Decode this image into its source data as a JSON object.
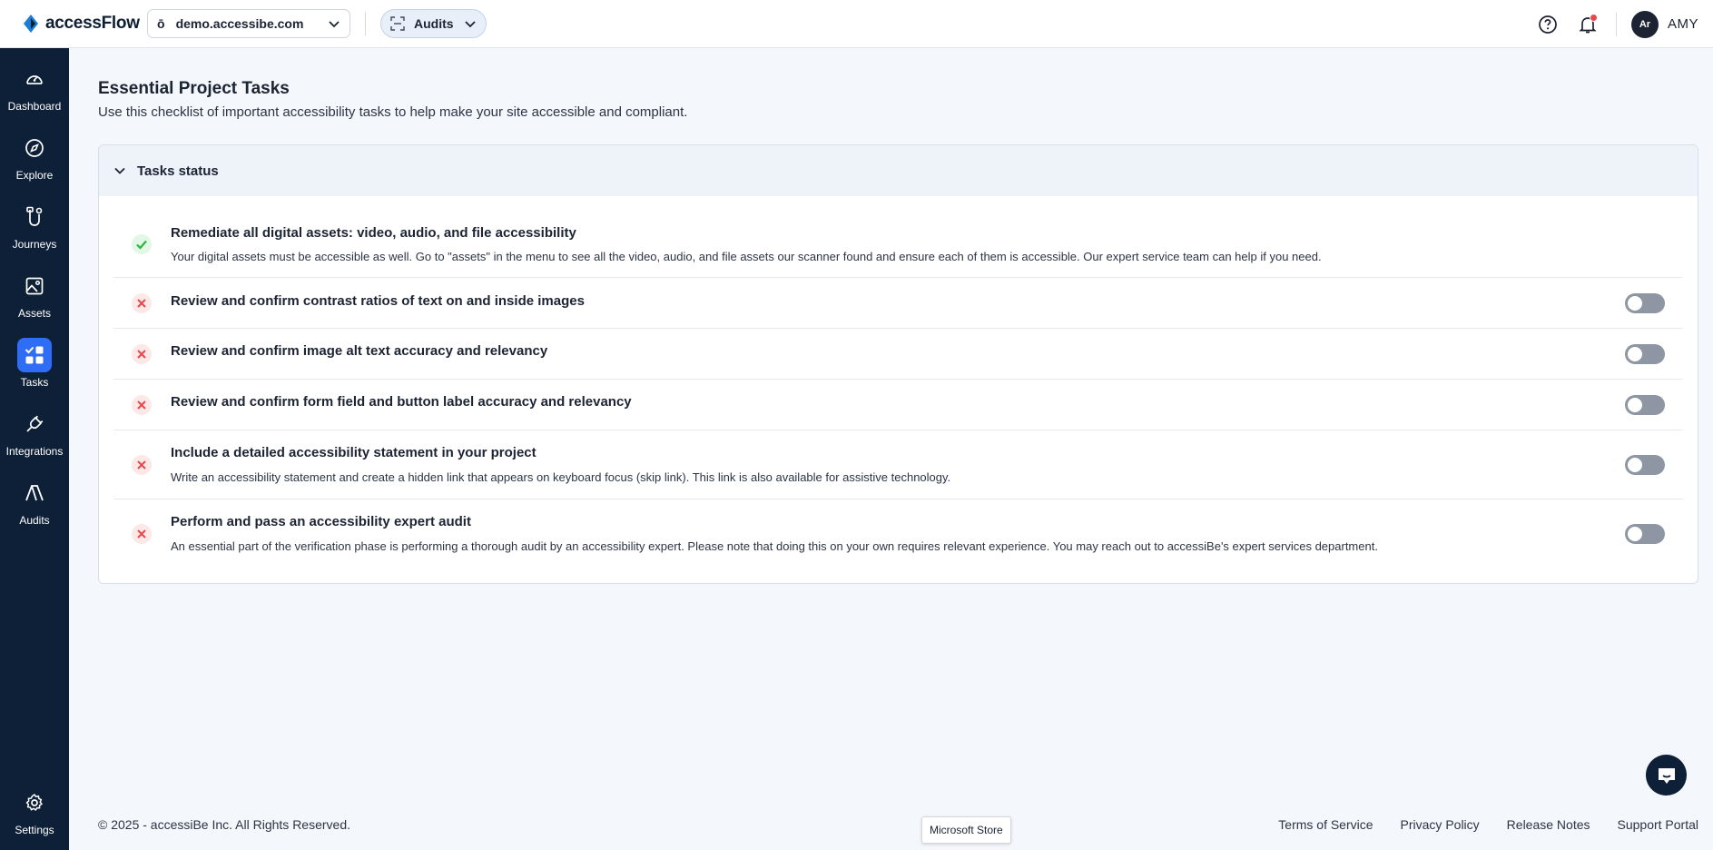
{
  "header": {
    "brand_name": "accessFlow",
    "site": "demo.accessibe.com",
    "section": "Audits",
    "user_initials": "Ar",
    "user_name": "AMY"
  },
  "sidebar": {
    "items": [
      {
        "label": "Dashboard",
        "icon": "dashboard-icon"
      },
      {
        "label": "Explore",
        "icon": "compass-icon"
      },
      {
        "label": "Journeys",
        "icon": "journeys-icon"
      },
      {
        "label": "Assets",
        "icon": "image-icon"
      },
      {
        "label": "Tasks",
        "icon": "tasks-icon",
        "active": true
      },
      {
        "label": "Integrations",
        "icon": "plug-icon"
      },
      {
        "label": "Audits",
        "icon": "audits-icon"
      }
    ],
    "settings_label": "Settings"
  },
  "main": {
    "title": "Essential Project Tasks",
    "subtitle": "Use this checklist of important accessibility tasks to help make your site accessible and compliant.",
    "card_title": "Tasks status",
    "tasks": [
      {
        "title": "Remediate all digital assets: video, audio, and file accessibility",
        "desc": "Your digital assets must be accessible as well. Go to \"assets\" in the menu to see all the video, audio, and file assets our scanner found and ensure each of them is accessible. Our expert service team can help if you need.",
        "done": true
      },
      {
        "title": "Review and confirm contrast ratios of text on and inside images",
        "desc": "",
        "done": false
      },
      {
        "title": "Review and confirm image alt text accuracy and relevancy",
        "desc": "",
        "done": false
      },
      {
        "title": "Review and confirm form field and button label accuracy and relevancy",
        "desc": "",
        "done": false
      },
      {
        "title": "Include a detailed accessibility statement in your project",
        "desc": "Write an accessibility statement and create a hidden link that appears on keyboard focus (skip link). This link is also available for assistive technology.",
        "done": false
      },
      {
        "title": "Perform and pass an accessibility expert audit",
        "desc": "An essential part of the verification phase is performing a thorough audit by an accessibility expert. Please note that doing this on your own requires relevant experience. You may reach out to accessiBe's expert services department.",
        "done": false
      }
    ]
  },
  "footer": {
    "copyright": "© 2025 - accessiBe Inc. All Rights Reserved.",
    "links": [
      "Terms of Service",
      "Privacy Policy",
      "Release Notes",
      "Support Portal"
    ],
    "tooltip": "Microsoft Store"
  },
  "colors": {
    "sidebar_bg": "#0e2037",
    "accent": "#2f6df6",
    "success": "#2fb344",
    "error": "#e5484d"
  }
}
